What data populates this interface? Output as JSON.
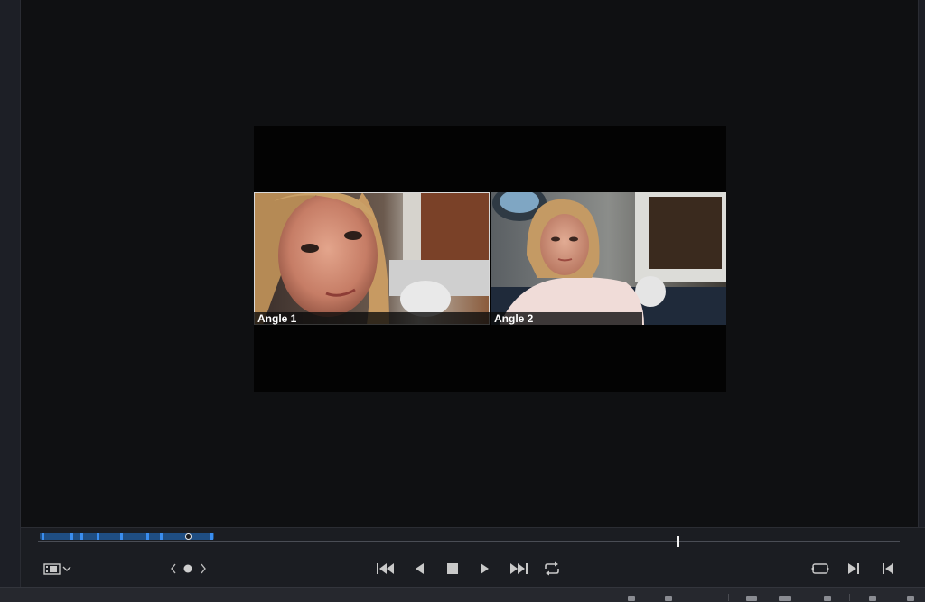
{
  "viewer": {
    "angles": [
      {
        "label": "Angle 1",
        "active": true
      },
      {
        "label": "Angle 2",
        "active": false
      }
    ]
  },
  "transport": {
    "controls": [
      "jump-to-start-icon",
      "play-reverse-icon",
      "stop-icon",
      "play-icon",
      "jump-to-end-icon",
      "loop-icon"
    ],
    "right_controls": [
      "match-frame-icon",
      "next-edit-icon",
      "previous-edit-icon"
    ],
    "view_menu_icon": "film-strip-icon"
  },
  "colors": {
    "accent_blue": "#3a8dee",
    "range_band": "#1f4e83",
    "playhead": "#f2f2f2"
  }
}
